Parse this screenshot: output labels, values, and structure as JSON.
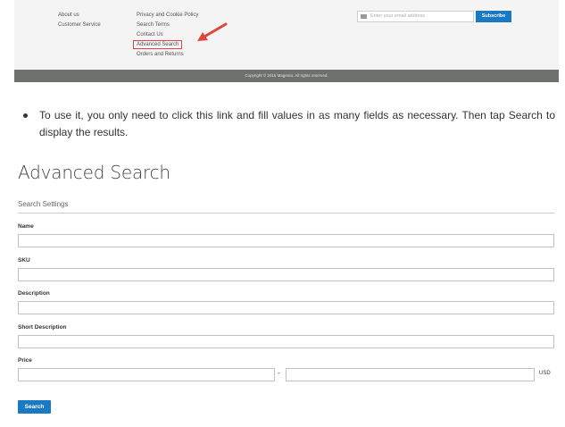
{
  "footer": {
    "col1": [
      "About us",
      "Customer Service"
    ],
    "col2": [
      "Privacy and Cookie Policy",
      "Search Terms",
      "Contact Us"
    ],
    "advanced_search_link": "Advanced Search",
    "orders_returns": "Orders and Returns",
    "newsletter_placeholder": "Enter your email address",
    "subscribe_label": "Subscribe",
    "copyright": "Copyright © 2015 Magento. All rights reserved."
  },
  "bullet_text": "To use it, you only need to click this link and fill values in as many fields as necessary. Then tap Search to display the results.",
  "form": {
    "title": "Advanced Search",
    "section": "Search Settings",
    "labels": {
      "name": "Name",
      "sku": "SKU",
      "description": "Description",
      "short_description": "Short Description",
      "price": "Price"
    },
    "price_separator": "-",
    "currency": "USD",
    "search_label": "Search"
  },
  "colors": {
    "accent": "#1979c3",
    "highlight": "#e0453a",
    "copyright_bar": "#6e716e"
  }
}
